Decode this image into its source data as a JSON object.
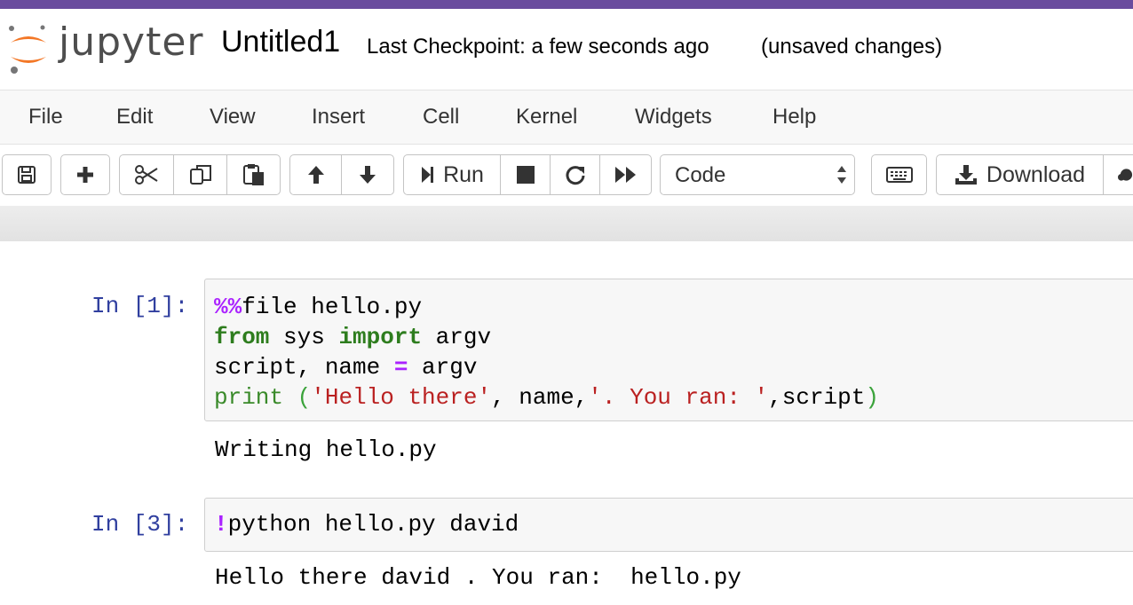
{
  "header": {
    "logo_text": "jupyter",
    "notebook_title": "Untitled1",
    "checkpoint": "Last Checkpoint: a few seconds ago",
    "status": "(unsaved changes)"
  },
  "menu": [
    "File",
    "Edit",
    "View",
    "Insert",
    "Cell",
    "Kernel",
    "Widgets",
    "Help"
  ],
  "toolbar": {
    "run_label": "Run",
    "cell_type": "Code",
    "download_label": "Download",
    "icons": [
      "save-icon",
      "plus-icon",
      "cut-icon",
      "copy-icon",
      "paste-icon",
      "arrow-up-icon",
      "arrow-down-icon",
      "step-run-icon",
      "stop-icon",
      "restart-icon",
      "fast-forward-icon",
      "keyboard-icon",
      "download-icon",
      "cloud-icon"
    ]
  },
  "cells": [
    {
      "prompt": "In [1]:",
      "lines": [
        {
          "magic": "%%",
          "rest": "file hello.py"
        },
        {
          "kw1": "from",
          "mid1": " sys ",
          "kw2": "import",
          "rest": " argv"
        },
        {
          "pre": "script, name ",
          "op": "=",
          "rest": " argv"
        },
        {
          "builtin": "print",
          "sp": " ",
          "lp": "(",
          "s1": "'Hello there'",
          "m1": ", name,",
          "s2": "'. You ran: '",
          "m2": ",script",
          "rp": ")"
        }
      ],
      "output": "Writing hello.py"
    },
    {
      "prompt": "In [3]:",
      "lines": [
        {
          "bang": "!",
          "rest": "python hello.py david"
        }
      ],
      "output": "Hello there david . You ran:  hello.py"
    }
  ],
  "colors": {
    "top_strip": "#6a4c9e",
    "logo_orange": "#f37726",
    "prompt_blue": "#303f9f",
    "keyword_green": "#2e7d1e",
    "magic_purple": "#aa22ff",
    "string_red": "#ba2121"
  }
}
